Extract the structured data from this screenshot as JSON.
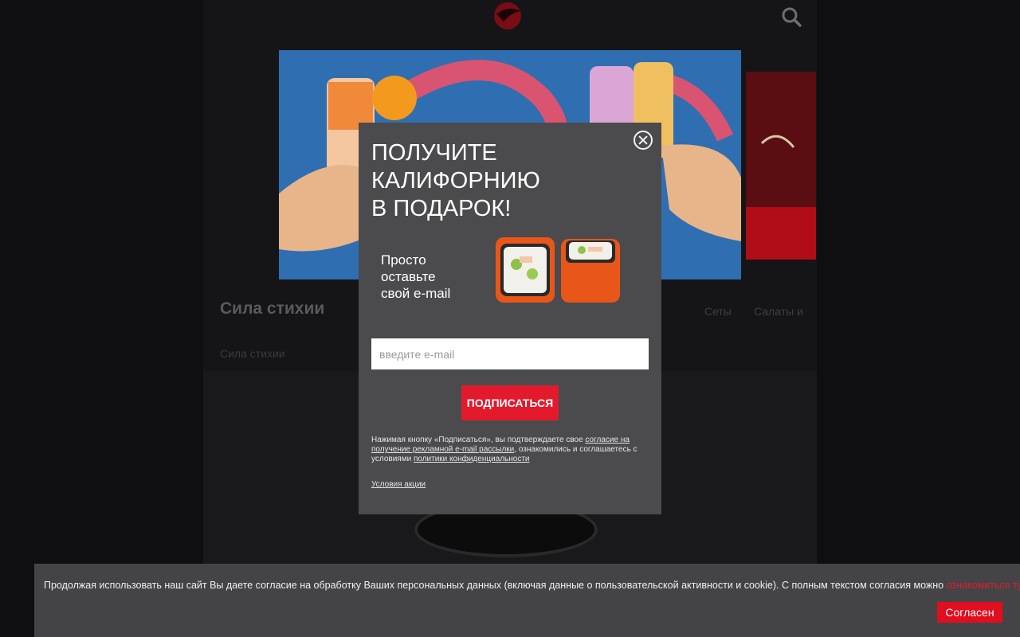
{
  "header": {
    "logo_icon": "brand-logo-icon",
    "search_icon": "search-icon"
  },
  "menu": {
    "section_title": "Сила стихии",
    "categories": [
      "Сеты",
      "Салаты и"
    ],
    "subcategory": "Сила стихии"
  },
  "modal": {
    "title_line1": "ПОЛУЧИТЕ",
    "title_line2": "КАЛИФОРНИЮ",
    "title_line3": "В ПОДАРОК!",
    "subtitle_line1": "Просто",
    "subtitle_line2": "оставьте",
    "subtitle_line3": "свой e-mail",
    "email_placeholder": "введите e-mail",
    "subscribe_label": "ПОДПИСАТЬСЯ",
    "consent_prefix": "Нажимая кнопку «Подписаться», вы подтверждаете свое",
    "consent_link": "согласие на получение рекламной e-mail рассылки",
    "consent_middle": ", ознакомились и соглашаетесь с условиями",
    "privacy_link": "политики конфиденциальности",
    "terms_link": "Условия акции"
  },
  "cookie": {
    "text": "Продолжая использовать наш сайт Вы даете согласие на обработку Ваших персональных данных (включая данные о пользовательской активности и cookie). С полным текстом согласия можно",
    "link": "ознакомиться тут",
    "suffix": ".",
    "agree_label": "Согласен"
  },
  "colors": {
    "accent": "#e21a2c",
    "modal_bg": "#4b4b4d",
    "cookie_bg": "#444446",
    "page_bg": "#0f0f11"
  }
}
